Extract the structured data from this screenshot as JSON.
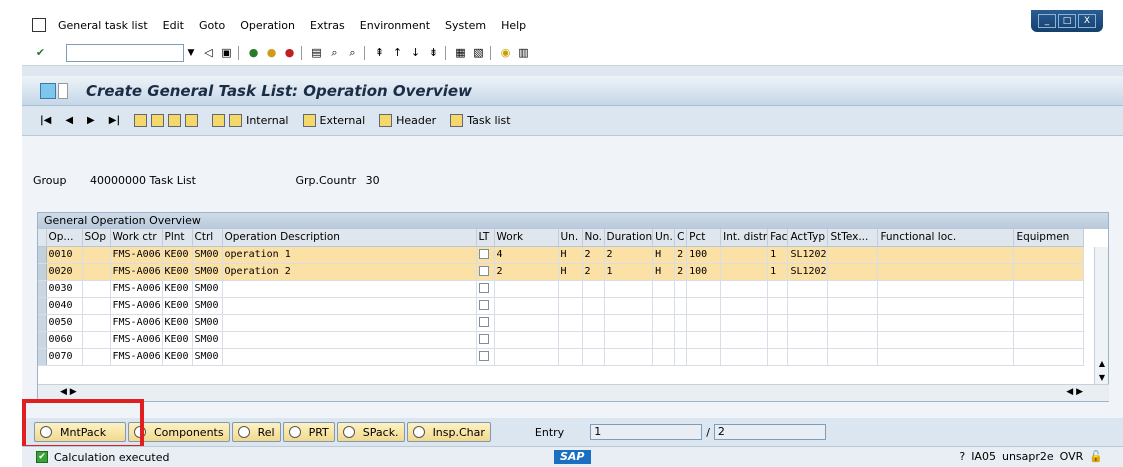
{
  "menu": [
    "General task list",
    "Edit",
    "Goto",
    "Operation",
    "Extras",
    "Environment",
    "System",
    "Help"
  ],
  "window_controls": [
    "_",
    "□",
    "X"
  ],
  "title": "Create General Task List: Operation Overview",
  "app_toolbar": {
    "internal": "Internal",
    "external": "External",
    "header": "Header",
    "task_list": "Task list"
  },
  "header": {
    "group_label": "Group",
    "group_value": "40000000 Task List",
    "counter_label": "Grp.Countr",
    "counter_value": "30"
  },
  "table_title": "General Operation Overview",
  "columns": [
    "Op...",
    "SOp",
    "Work ctr",
    "Plnt",
    "Ctrl",
    "Operation Description",
    "LT",
    "Work",
    "Un.",
    "No.",
    "Duration",
    "Un.",
    "C",
    "Pct",
    "Int. distr",
    "Fac",
    "ActTyp",
    "StTex...",
    "Functional loc.",
    "Equipmen"
  ],
  "rows": [
    {
      "op": "0010",
      "sop": "",
      "wc": "FMS-A006",
      "plnt": "KE00",
      "ctrl": "SM00",
      "desc": "operation 1",
      "work": "4",
      "un": "H",
      "no": "2",
      "dur": "2",
      "un2": "H",
      "c": "2",
      "pct": "100",
      "fac": "1",
      "act": "SL1202",
      "hl": true
    },
    {
      "op": "0020",
      "sop": "",
      "wc": "FMS-A006",
      "plnt": "KE00",
      "ctrl": "SM00",
      "desc": "Operation 2",
      "work": "2",
      "un": "H",
      "no": "2",
      "dur": "1",
      "un2": "H",
      "c": "2",
      "pct": "100",
      "fac": "1",
      "act": "SL1202",
      "hl": true
    },
    {
      "op": "0030",
      "sop": "",
      "wc": "FMS-A006",
      "plnt": "KE00",
      "ctrl": "SM00",
      "desc": "",
      "work": "",
      "un": "",
      "no": "",
      "dur": "",
      "un2": "",
      "c": "",
      "pct": "",
      "fac": "",
      "act": "",
      "hl": false
    },
    {
      "op": "0040",
      "sop": "",
      "wc": "FMS-A006",
      "plnt": "KE00",
      "ctrl": "SM00",
      "desc": "",
      "work": "",
      "un": "",
      "no": "",
      "dur": "",
      "un2": "",
      "c": "",
      "pct": "",
      "fac": "",
      "act": "",
      "hl": false
    },
    {
      "op": "0050",
      "sop": "",
      "wc": "FMS-A006",
      "plnt": "KE00",
      "ctrl": "SM00",
      "desc": "",
      "work": "",
      "un": "",
      "no": "",
      "dur": "",
      "un2": "",
      "c": "",
      "pct": "",
      "fac": "",
      "act": "",
      "hl": false
    },
    {
      "op": "0060",
      "sop": "",
      "wc": "FMS-A006",
      "plnt": "KE00",
      "ctrl": "SM00",
      "desc": "",
      "work": "",
      "un": "",
      "no": "",
      "dur": "",
      "un2": "",
      "c": "",
      "pct": "",
      "fac": "",
      "act": "",
      "hl": false
    },
    {
      "op": "0070",
      "sop": "",
      "wc": "FMS-A006",
      "plnt": "KE00",
      "ctrl": "SM00",
      "desc": "",
      "work": "",
      "un": "",
      "no": "",
      "dur": "",
      "un2": "",
      "c": "",
      "pct": "",
      "fac": "",
      "act": "",
      "hl": false
    }
  ],
  "bottom_buttons": [
    "MntPack",
    "Components",
    "Rel",
    "PRT",
    "SPack.",
    "Insp.Char"
  ],
  "entry": {
    "label": "Entry",
    "current": "1",
    "total": "2"
  },
  "status": {
    "message": "Calculation executed",
    "system": "IA05",
    "server": "unsapr2e",
    "mode": "OVR",
    "logo": "SAP"
  }
}
